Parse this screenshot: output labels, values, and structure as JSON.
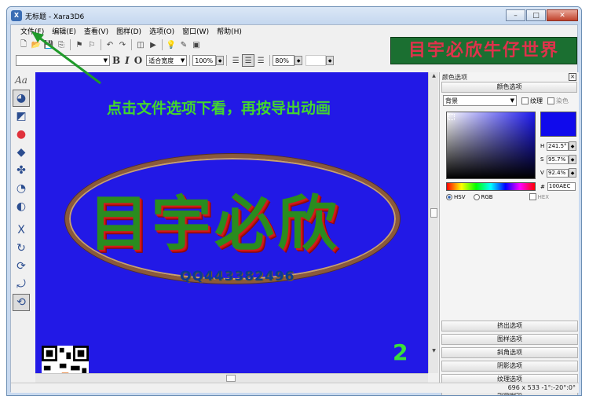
{
  "window": {
    "title": "无标题 - Xara3D6",
    "icon_name": "xara-app-icon",
    "min_label": "–",
    "max_label": "□",
    "close_label": "✕"
  },
  "menu": [
    {
      "label": "文件(F)"
    },
    {
      "label": "编辑(E)"
    },
    {
      "label": "查看(V)"
    },
    {
      "label": "图样(D)"
    },
    {
      "label": "选项(O)"
    },
    {
      "label": "窗口(W)"
    },
    {
      "label": "帮助(H)"
    }
  ],
  "banner": {
    "text": "目宇必欣牛仔世界",
    "color": "#1b6f31"
  },
  "toolbar2": {
    "font_combo": "",
    "bold": "B",
    "italic": "I",
    "outline": "O",
    "zoom_fit": "适合宽度",
    "zoom_percent": "100%",
    "line_spacing": "80%"
  },
  "canvas": {
    "background": "#2219e6",
    "instruction": "点击文件选项下看，再按导出动画",
    "main_text": "目宇必欣",
    "qq_text": "QQ443382496",
    "page_number": "2"
  },
  "panel": {
    "title": "颜色选项",
    "close": "✕",
    "header": "颜色选项",
    "target_combo": "背景",
    "texture_label": "纹理",
    "dye_label": "染色",
    "h_value": "241.5°",
    "s_value": "95.7%",
    "v_value": "92.4%",
    "hex_value": "100AEC",
    "hex_prefix": "#",
    "mode_hsv": "HSV",
    "mode_rgb": "RGB",
    "mode_hex": "HEX",
    "swatch_color": "#100AEC",
    "sections": [
      {
        "label": "挤出选项"
      },
      {
        "label": "图样选项"
      },
      {
        "label": "斜角选项"
      },
      {
        "label": "阴影选项"
      },
      {
        "label": "纹理选项"
      },
      {
        "label": "动画选项"
      }
    ]
  },
  "status": {
    "text": "696 x 533  -1°:-20°:0°"
  }
}
